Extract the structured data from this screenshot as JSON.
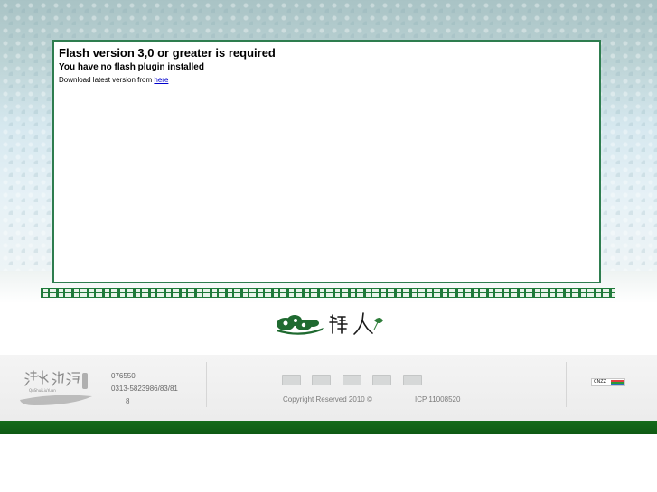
{
  "flash": {
    "title": "Flash version 3,0 or greater is required",
    "subtitle": "You have no flash plugin installed",
    "download_prefix": "Download latest version from ",
    "download_link": "here"
  },
  "footer": {
    "info_line1": "076550",
    "info_line2": "0313-5823986/83/81",
    "info_line3": "8",
    "copyright": "Copyright Reserved 2010 ©",
    "icp": "ICP 11008520",
    "cnzz_label": "CNZZ"
  },
  "colors": {
    "frame_green": "#2e7d4f",
    "bottom_bar_green": "#156c1a",
    "link_blue": "#0000cc"
  }
}
